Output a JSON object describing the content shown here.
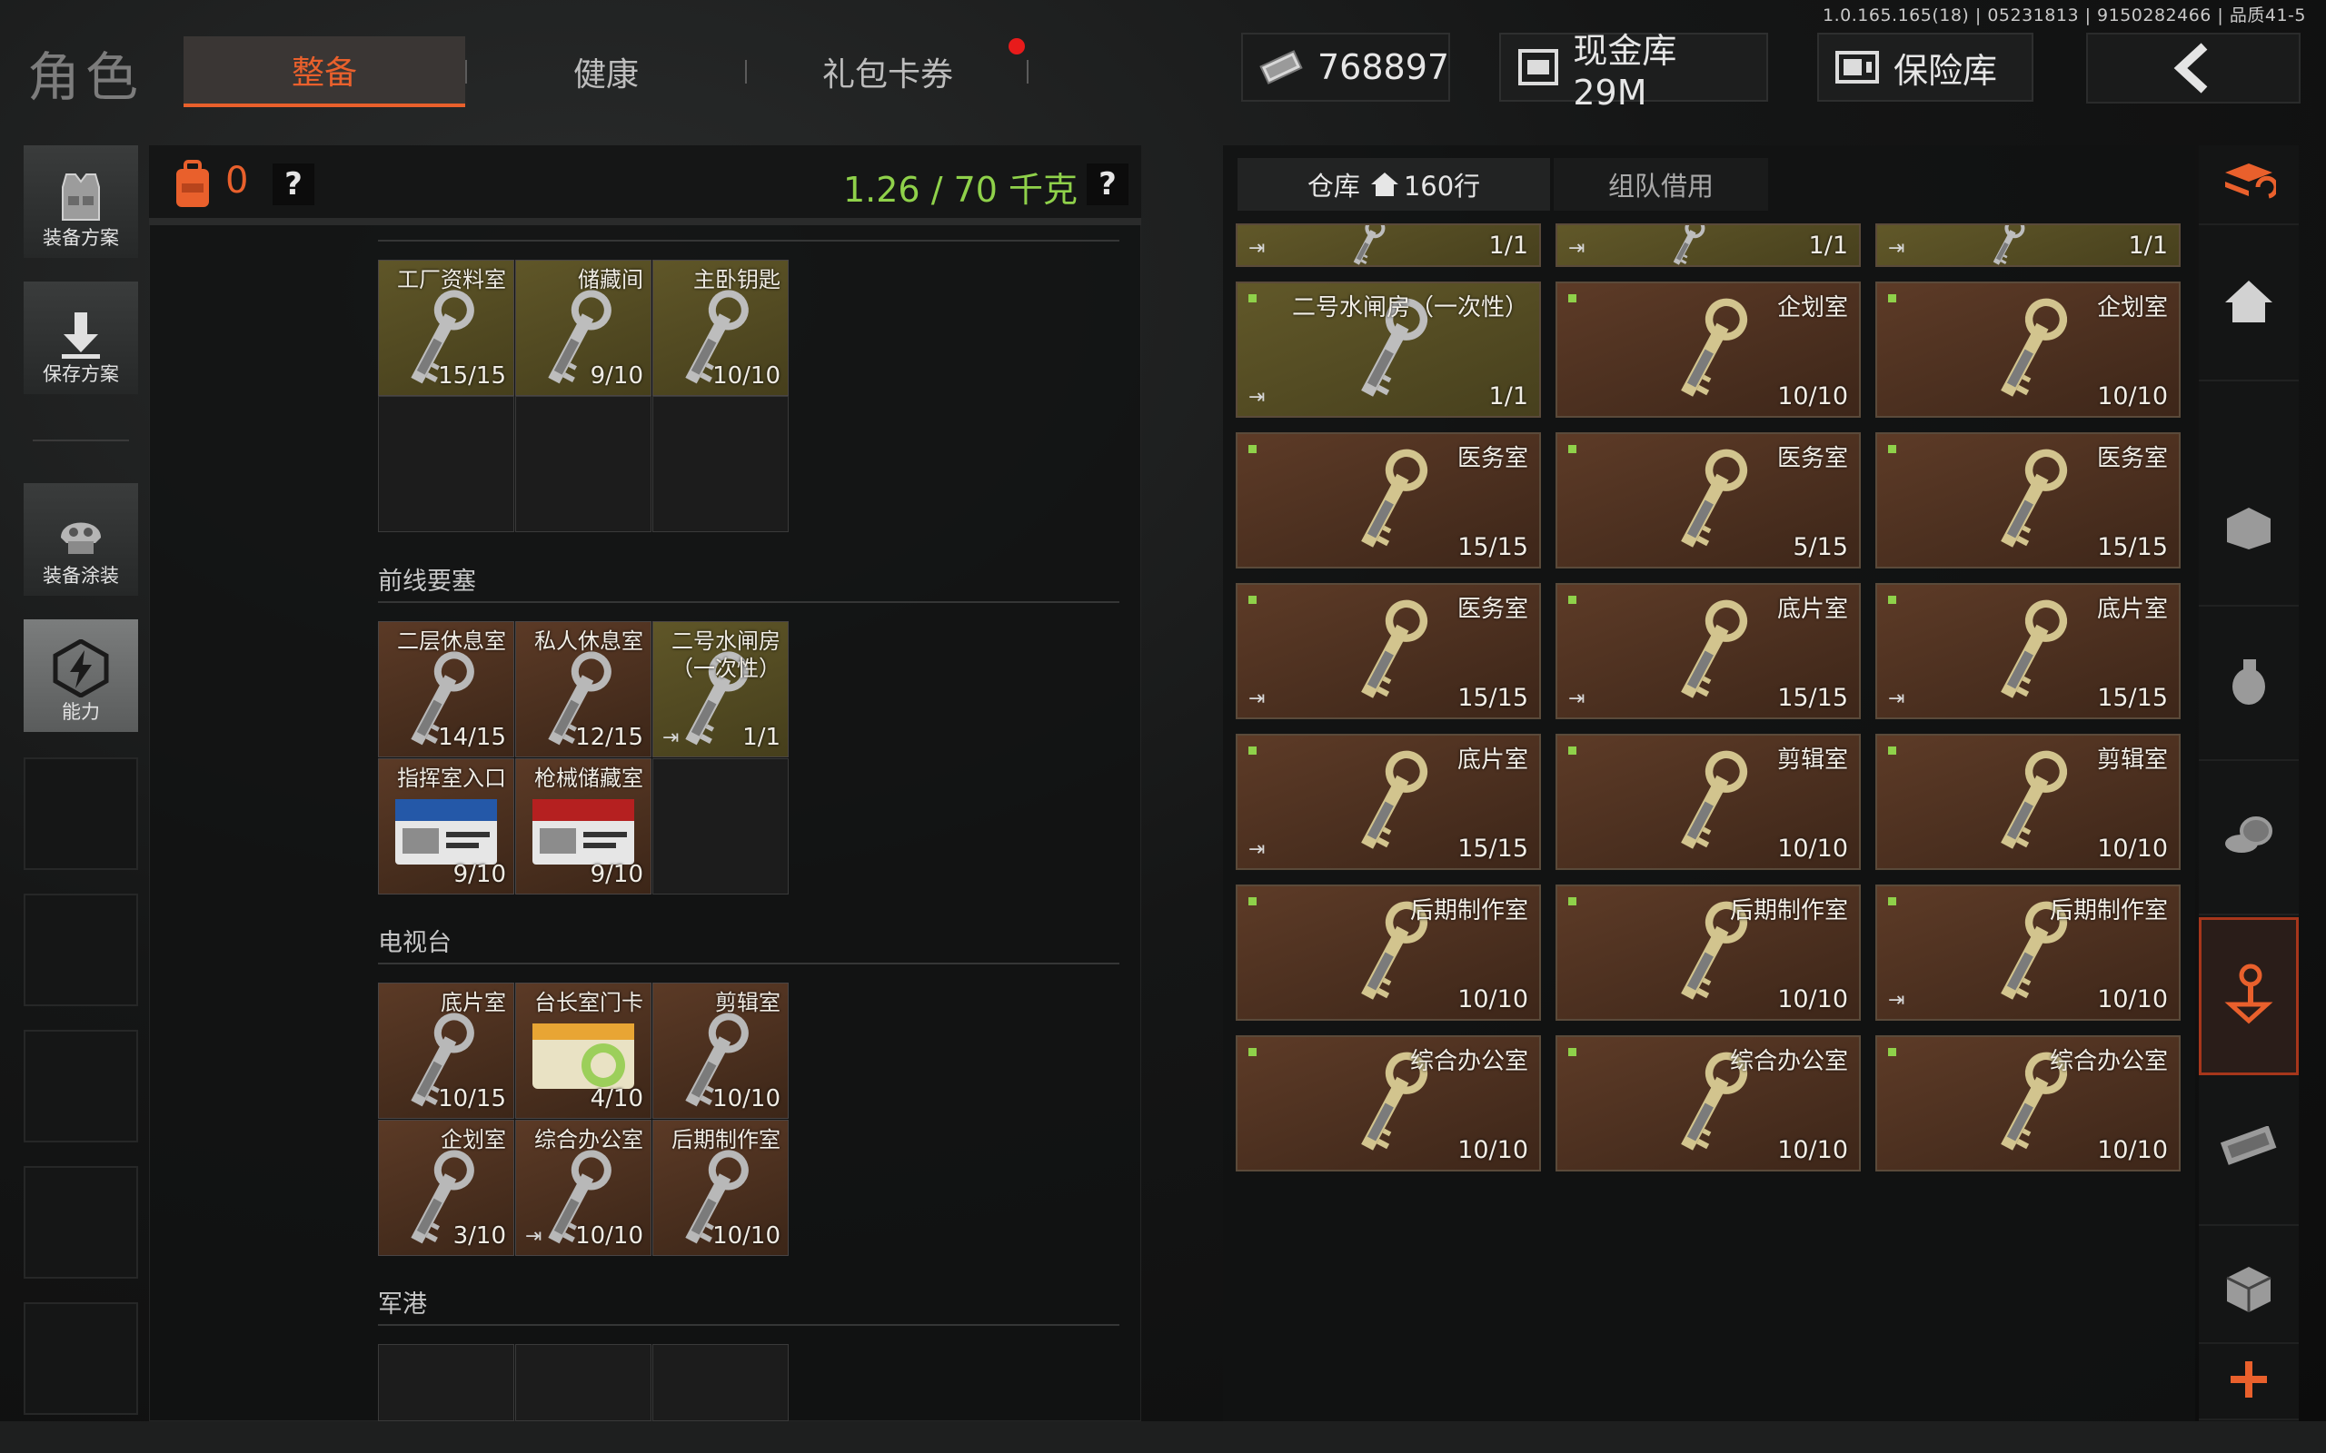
{
  "version": "1.0.165.165(18) | 05231813 | 9150282466 | 品质41-5",
  "title": "角色",
  "tabs": [
    {
      "label": "整备",
      "active": true
    },
    {
      "label": "健康",
      "active": false
    },
    {
      "label": "礼包卡券",
      "active": false
    }
  ],
  "currency": {
    "money": "768897",
    "cash_vault": "现金库 29M",
    "safe": "保险库"
  },
  "left_rail": [
    {
      "label": "装备方案",
      "icon": "vest-icon"
    },
    {
      "label": "保存方案",
      "icon": "download-icon"
    },
    {
      "label": "装备涂装",
      "icon": "helmet-icon"
    },
    {
      "label": "能力",
      "icon": "lightning-icon"
    }
  ],
  "equipment": {
    "bag_count": "0",
    "help": "?",
    "weight": "1.26 / 70 千克",
    "top_row": [
      {
        "name": "工厂资料室",
        "count": "15/15",
        "style": "gold"
      },
      {
        "name": "储藏间",
        "count": "9/10",
        "style": "gold"
      },
      {
        "name": "主卧钥匙",
        "count": "10/10",
        "style": "gold"
      }
    ],
    "sections": [
      {
        "title": "前线要塞",
        "items": [
          {
            "name": "二层休息室",
            "count": "14/15",
            "style": "brown"
          },
          {
            "name": "私人休息室",
            "count": "12/15",
            "style": "brown"
          },
          {
            "name": "二号水闸房\n（一次性）",
            "count": "1/1",
            "style": "gold",
            "exit": true
          },
          {
            "name": "指挥室入口",
            "count": "9/10",
            "style": "brown",
            "card": "blue"
          },
          {
            "name": "枪械储藏室",
            "count": "9/10",
            "style": "brown",
            "card": "red"
          }
        ]
      },
      {
        "title": "电视台",
        "items": [
          {
            "name": "底片室",
            "count": "10/15",
            "style": "brown"
          },
          {
            "name": "台长室门卡",
            "count": "4/10",
            "style": "brown",
            "card": "yellow"
          },
          {
            "name": "剪辑室",
            "count": "10/10",
            "style": "brown"
          },
          {
            "name": "企划室",
            "count": "3/10",
            "style": "brown"
          },
          {
            "name": "综合办公室",
            "count": "10/10",
            "style": "brown",
            "exit": true
          },
          {
            "name": "后期制作室",
            "count": "10/10",
            "style": "brown"
          }
        ]
      },
      {
        "title": "军港",
        "items": []
      }
    ]
  },
  "warehouse": {
    "tabs": [
      {
        "label": "仓库",
        "suffix": "160行",
        "active": true
      },
      {
        "label": "组队借用",
        "active": false
      }
    ],
    "top_row": [
      {
        "count": "1/1",
        "exit": true
      },
      {
        "count": "1/1",
        "exit": true
      },
      {
        "count": "1/1",
        "exit": true
      }
    ],
    "items": [
      {
        "name": "二号水闸房（一次性）",
        "count": "1/1",
        "style": "gold",
        "exit": true
      },
      {
        "name": "企划室",
        "count": "10/10",
        "style": "brown"
      },
      {
        "name": "企划室",
        "count": "10/10",
        "style": "brown"
      },
      {
        "name": "医务室",
        "count": "15/15",
        "style": "brown"
      },
      {
        "name": "医务室",
        "count": "5/15",
        "style": "brown"
      },
      {
        "name": "医务室",
        "count": "15/15",
        "style": "brown"
      },
      {
        "name": "医务室",
        "count": "15/15",
        "style": "brown",
        "exit": true
      },
      {
        "name": "底片室",
        "count": "15/15",
        "style": "brown",
        "exit": true
      },
      {
        "name": "底片室",
        "count": "15/15",
        "style": "brown",
        "exit": true
      },
      {
        "name": "底片室",
        "count": "15/15",
        "style": "brown",
        "exit": true
      },
      {
        "name": "剪辑室",
        "count": "10/10",
        "style": "brown"
      },
      {
        "name": "剪辑室",
        "count": "10/10",
        "style": "brown"
      },
      {
        "name": "后期制作室",
        "count": "10/10",
        "style": "brown"
      },
      {
        "name": "后期制作室",
        "count": "10/10",
        "style": "brown"
      },
      {
        "name": "后期制作室",
        "count": "10/10",
        "style": "brown",
        "exit": true
      },
      {
        "name": "综合办公室",
        "count": "10/10",
        "style": "brown"
      },
      {
        "name": "综合办公室",
        "count": "10/10",
        "style": "brown"
      },
      {
        "name": "综合办公室",
        "count": "10/10",
        "style": "brown"
      }
    ]
  },
  "right_rail": [
    "sort-icon",
    "home-icon",
    "armor-icon",
    "grenade-icon",
    "coins-icon",
    "key-icon",
    "cash-icon",
    "box-icon",
    "plus-icon"
  ],
  "colors": {
    "accent": "#e9602c",
    "weight_green": "#8fd14a",
    "notif": "#e81b1b"
  }
}
